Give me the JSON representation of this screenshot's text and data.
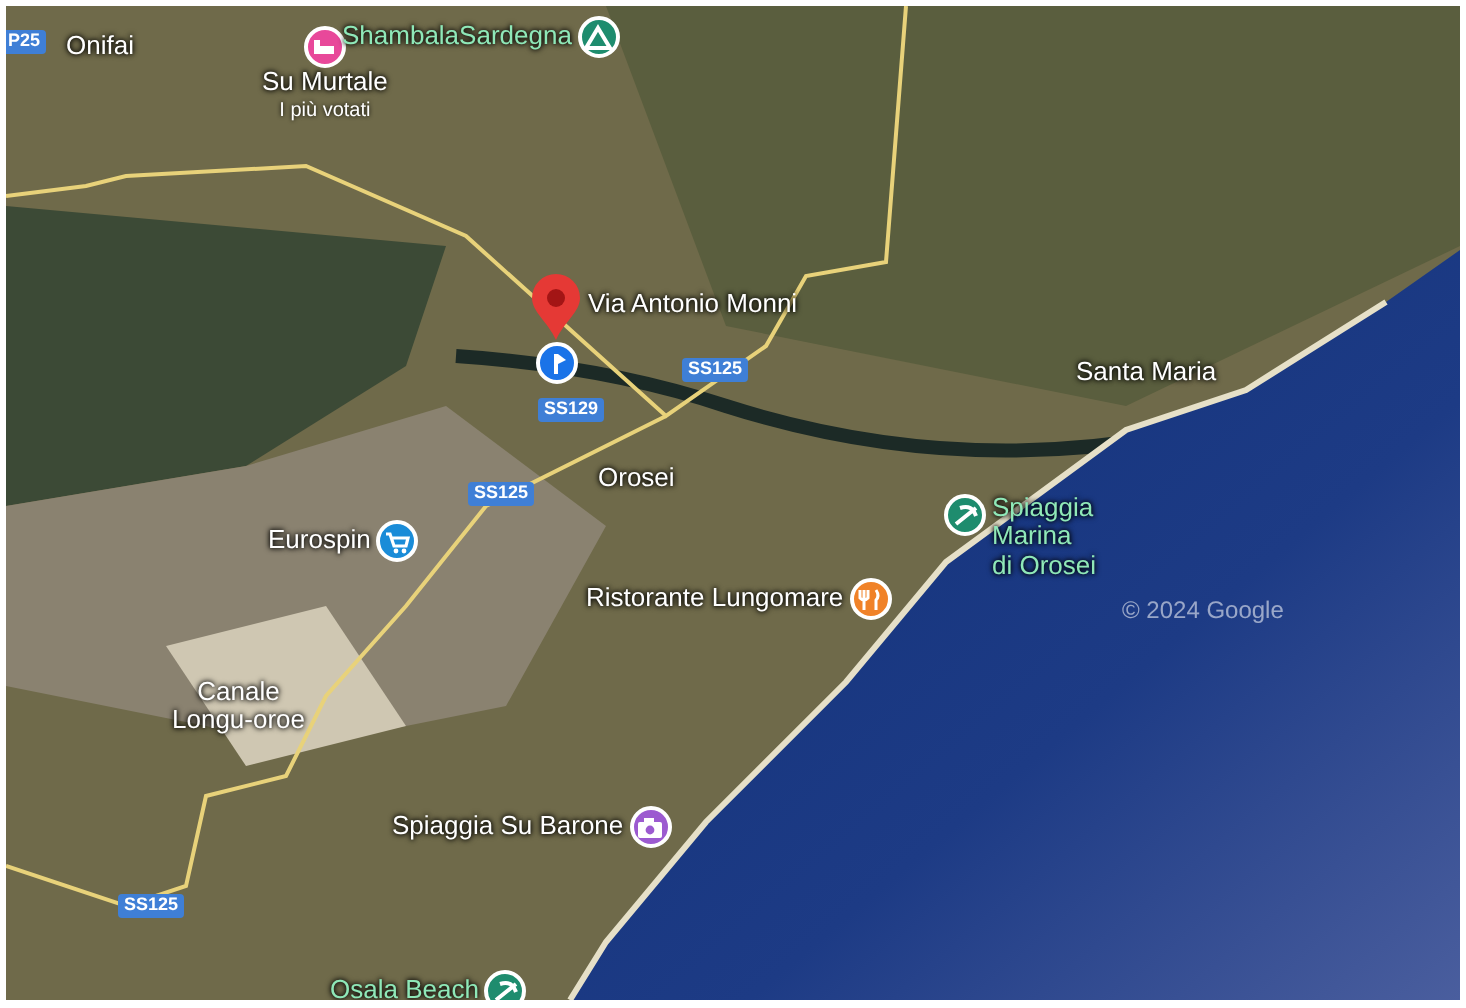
{
  "map": {
    "labels": [
      {
        "kind": "shield",
        "text": "P25"
      },
      {
        "kind": "town",
        "text": "Onifai"
      },
      {
        "kind": "hotel",
        "text": "Su Murtale",
        "note": "I più votati",
        "color": "#e8489a"
      },
      {
        "kind": "campsite",
        "text": "ShambalaSardegna",
        "color": "#1e8c6e"
      },
      {
        "kind": "pin",
        "text": "Via Antonio Monni",
        "color": "#1a73e8"
      },
      {
        "kind": "shield",
        "text": "SS125"
      },
      {
        "kind": "town",
        "text": "Santa Maria"
      },
      {
        "kind": "shield",
        "text": "SS129"
      },
      {
        "kind": "town",
        "text": "Orosei"
      },
      {
        "kind": "shield",
        "text": "SS125"
      },
      {
        "kind": "shop",
        "text": "Eurospin",
        "color": "#1a8cd8"
      },
      {
        "kind": "beach",
        "text": "Spiaggia\nMarina\ndi Orosei",
        "color": "#1e8c6e"
      },
      {
        "kind": "restaurant",
        "text": "Ristorante Lungomare",
        "color": "#f08228"
      },
      {
        "kind": "town",
        "text": "Canale\nLongu-oroe"
      },
      {
        "kind": "photo",
        "text": "Spiaggia Su Barone",
        "color": "#9c5ad0"
      },
      {
        "kind": "shield",
        "text": "SS125"
      },
      {
        "kind": "beach",
        "text": "Osala Beach",
        "color": "#1e8c6e"
      }
    ],
    "attribution": "© 2024 Google"
  }
}
